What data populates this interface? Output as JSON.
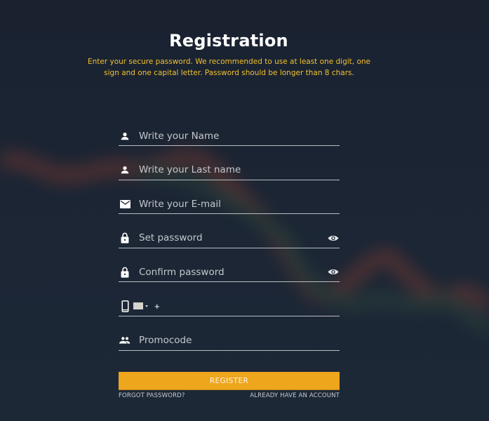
{
  "header": {
    "title": "Registration",
    "subtitle": "Enter your secure password. We recommended to use at least one digit, one sign and one capital letter. Password should be longer than 8 chars."
  },
  "form": {
    "fields": [
      {
        "name": "first-name",
        "icon": "person-icon",
        "placeholder": "Write your Name",
        "value": ""
      },
      {
        "name": "last-name",
        "icon": "person-icon",
        "placeholder": "Write your Last name",
        "value": ""
      },
      {
        "name": "email",
        "icon": "mail-icon",
        "placeholder": "Write your E-mail",
        "value": ""
      },
      {
        "name": "password",
        "icon": "lock-icon",
        "placeholder": "Set password",
        "value": "",
        "toggle_icon": "eye-icon"
      },
      {
        "name": "confirm-password",
        "icon": "lock-icon",
        "placeholder": "Confirm password",
        "value": "",
        "toggle_icon": "eye-icon"
      },
      {
        "name": "phone",
        "icon": "phone-icon",
        "prefix": "+",
        "value": "",
        "country_selector": "flag-dropdown"
      },
      {
        "name": "promocode",
        "icon": "group-icon",
        "placeholder": "Promocode",
        "value": ""
      }
    ]
  },
  "actions": {
    "register_label": "REGISTER",
    "forgot_password_label": "FORGOT PASSWORD?",
    "have_account_label": "ALREADY HAVE AN ACCOUNT"
  },
  "colors": {
    "background": "#1b2432",
    "accent": "#eea61c",
    "subtitle": "#f0c030",
    "text": "#ffffff",
    "placeholder": "#c4c8cd",
    "underline": "#b9bdc2"
  }
}
